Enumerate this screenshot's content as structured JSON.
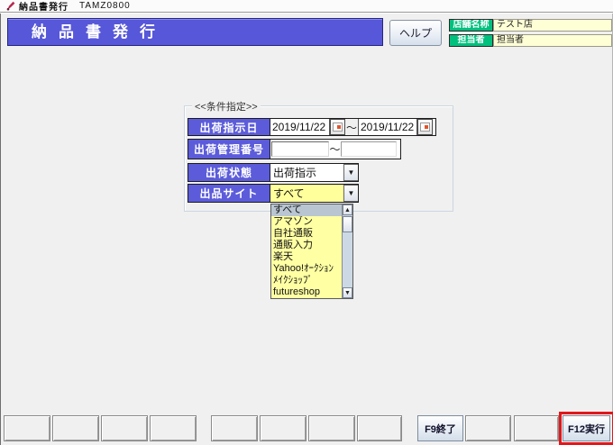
{
  "window": {
    "title": "納品書発行",
    "code": "TAMZ0800"
  },
  "header": {
    "banner": "納品書発行",
    "help_button": "ヘルプ",
    "store_label": "店舗名称",
    "store_value": "テスト店",
    "person_label": "担当者",
    "person_value": "担当者"
  },
  "conditions": {
    "group_title": "<<条件指定>>",
    "ship_date": {
      "label": "出荷指示日",
      "from": "2019/11/22",
      "to": "2019/11/22",
      "separator": "～"
    },
    "ship_no": {
      "label": "出荷管理番号",
      "from": "",
      "to": "",
      "separator": "～"
    },
    "ship_status": {
      "label": "出荷状態",
      "value": "出荷指示"
    },
    "listing_site": {
      "label": "出品サイト",
      "value": "すべて",
      "selected_index": 0,
      "options": [
        "すべて",
        "アマゾン",
        "自社通販",
        "通販入力",
        "楽天",
        "Yahoo!ｵｰｸｼｮﾝ",
        "ﾒｲｸｼｮｯﾌﾟ",
        "futureshop"
      ]
    }
  },
  "footer": {
    "f9_label": "F9終了",
    "f12_label": "F12実行"
  },
  "colors": {
    "banner_blue": "#5757d9",
    "label_blue": "#5c5cdb",
    "green": "#00c07e",
    "pale_yellow": "#ffffd6",
    "combo_yellow": "#ffff9c",
    "list_yellow": "#ffffa3",
    "selection_blue": "#b9c6d2",
    "highlight_red": "#e3171b",
    "window_gray": "#f0f0f0"
  }
}
